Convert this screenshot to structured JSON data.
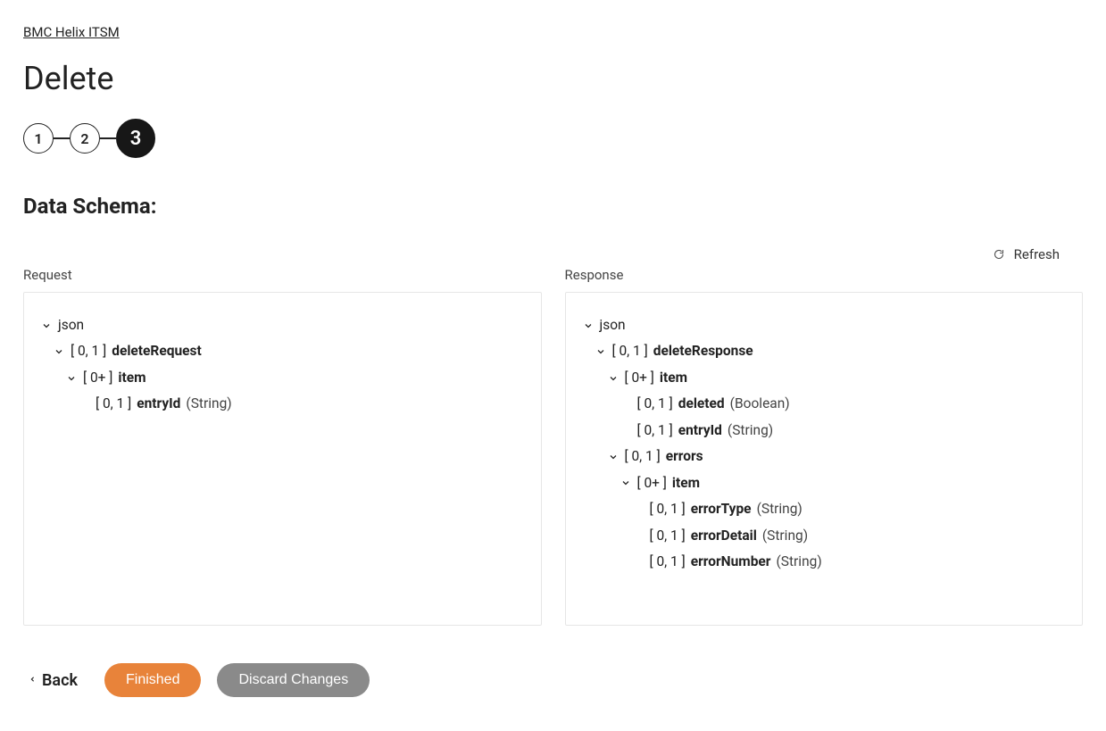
{
  "breadcrumb": "BMC Helix ITSM",
  "page_title": "Delete",
  "stepper": {
    "steps": [
      "1",
      "2",
      "3"
    ],
    "active_index": 2
  },
  "section_title": "Data Schema:",
  "refresh_label": "Refresh",
  "request_label": "Request",
  "response_label": "Response",
  "request_tree": {
    "root": "json",
    "deleteRequest": {
      "card": "[ 0, 1 ]",
      "name": "deleteRequest"
    },
    "item": {
      "card": "[ 0+ ]",
      "name": "item"
    },
    "entryId": {
      "card": "[ 0, 1 ]",
      "name": "entryId",
      "type": "(String)"
    }
  },
  "response_tree": {
    "root": "json",
    "deleteResponse": {
      "card": "[ 0, 1 ]",
      "name": "deleteResponse"
    },
    "item": {
      "card": "[ 0+ ]",
      "name": "item"
    },
    "deleted": {
      "card": "[ 0, 1 ]",
      "name": "deleted",
      "type": "(Boolean)"
    },
    "entryId": {
      "card": "[ 0, 1 ]",
      "name": "entryId",
      "type": "(String)"
    },
    "errors": {
      "card": "[ 0, 1 ]",
      "name": "errors"
    },
    "errors_item": {
      "card": "[ 0+ ]",
      "name": "item"
    },
    "errorType": {
      "card": "[ 0, 1 ]",
      "name": "errorType",
      "type": "(String)"
    },
    "errorDetail": {
      "card": "[ 0, 1 ]",
      "name": "errorDetail",
      "type": "(String)"
    },
    "errorNumber": {
      "card": "[ 0, 1 ]",
      "name": "errorNumber",
      "type": "(String)"
    }
  },
  "actions": {
    "back": "Back",
    "finished": "Finished",
    "discard": "Discard Changes"
  }
}
